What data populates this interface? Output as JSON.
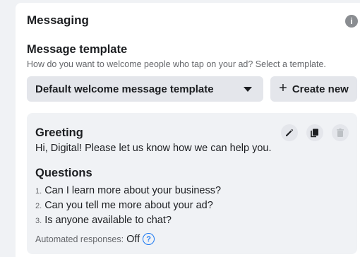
{
  "messaging": {
    "title": "Messaging",
    "info_icon": "info-icon"
  },
  "template": {
    "title": "Message template",
    "subtitle": "How do you want to welcome people who tap on your ad? Select a template.",
    "selected": "Default welcome message template",
    "create_label": "Create new"
  },
  "preview": {
    "greeting_title": "Greeting",
    "greeting_text": "Hi, Digital! Please let us know how we can help you.",
    "questions_title": "Questions",
    "questions": [
      {
        "num": "1.",
        "text": "Can I learn more about your business?"
      },
      {
        "num": "2.",
        "text": "Can you tell me more about your ad?"
      },
      {
        "num": "3.",
        "text": "Is anyone available to chat?"
      }
    ],
    "auto_label": "Automated responses:",
    "auto_value": "Off",
    "tools": [
      "edit-icon",
      "copy-icon",
      "delete-icon"
    ]
  },
  "colors": {
    "accent": "#1877f2",
    "button_bg": "#e4e6eb",
    "panel_bg": "#f0f2f5"
  }
}
